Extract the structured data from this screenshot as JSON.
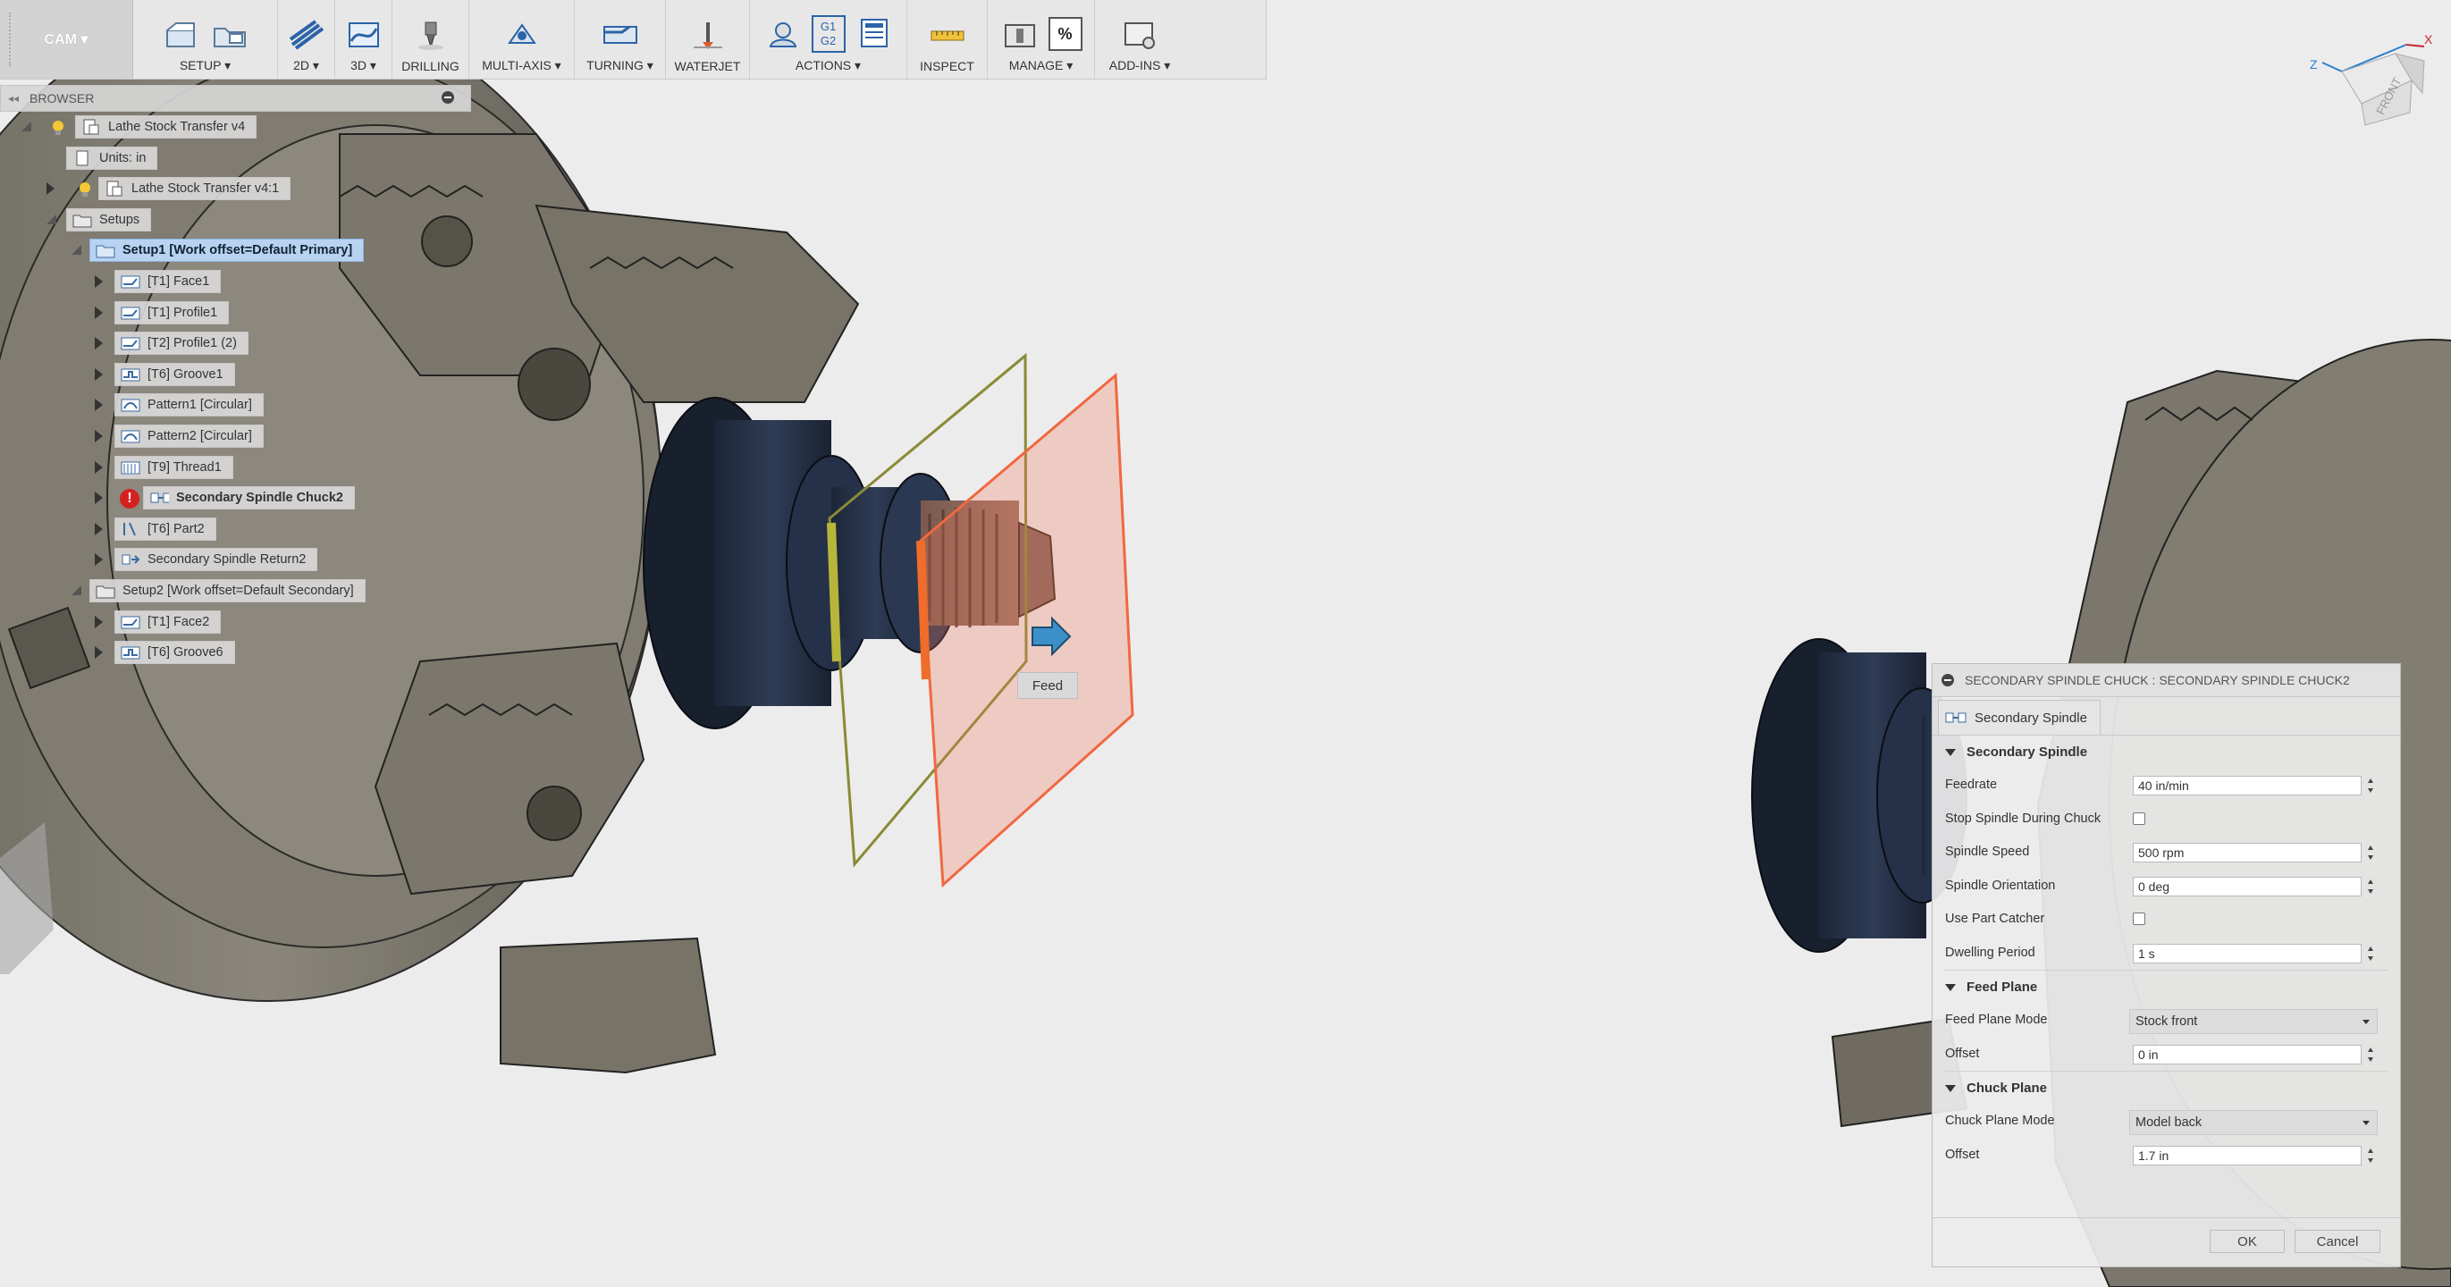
{
  "toolbar": {
    "workspace": "CAM ▾",
    "groups": [
      {
        "label": "SETUP ▾"
      },
      {
        "label": "2D ▾"
      },
      {
        "label": "3D ▾"
      },
      {
        "label": "DRILLING"
      },
      {
        "label": "MULTI-AXIS ▾"
      },
      {
        "label": "TURNING ▾"
      },
      {
        "label": "WATERJET"
      },
      {
        "label": "ACTIONS ▾"
      },
      {
        "label": "INSPECT"
      },
      {
        "label": "MANAGE ▾"
      },
      {
        "label": "ADD-INS ▾"
      }
    ],
    "actions_g1": "G1",
    "actions_g2": "G2",
    "manage_percent": "%"
  },
  "browser": {
    "title": "BROWSER",
    "items": [
      {
        "label": "Lathe Stock Transfer v4"
      },
      {
        "label": "Units: in"
      },
      {
        "label": "Lathe Stock Transfer v4:1"
      },
      {
        "label": "Setups"
      },
      {
        "label": "Setup1 [Work offset=Default Primary]"
      },
      {
        "label": "[T1] Face1"
      },
      {
        "label": "[T1] Profile1"
      },
      {
        "label": "[T2] Profile1 (2)"
      },
      {
        "label": "[T6] Groove1"
      },
      {
        "label": "Pattern1 [Circular]"
      },
      {
        "label": "Pattern2 [Circular]"
      },
      {
        "label": "[T9] Thread1"
      },
      {
        "label": "Secondary Spindle Chuck2"
      },
      {
        "label": "[T6] Part2"
      },
      {
        "label": "Secondary Spindle Return2"
      },
      {
        "label": "Setup2 [Work offset=Default Secondary]"
      },
      {
        "label": "[T1] Face2"
      },
      {
        "label": "[T6] Groove6"
      }
    ],
    "error_mark": "!"
  },
  "viewport": {
    "feed_label": "Feed",
    "viewcube_face": "FRONT",
    "axis_z": "Z",
    "axis_x": "X"
  },
  "dialog": {
    "title": "SECONDARY SPINDLE CHUCK : SECONDARY SPINDLE CHUCK2",
    "tab": "Secondary Spindle",
    "section1": "Secondary Spindle",
    "feedrate_label": "Feedrate",
    "feedrate_value": "40 in/min",
    "stop_spindle_label": "Stop Spindle During Chuck",
    "stop_spindle_checked": false,
    "spindle_speed_label": "Spindle Speed",
    "spindle_speed_value": "500 rpm",
    "spindle_orientation_label": "Spindle Orientation",
    "spindle_orientation_value": "0 deg",
    "use_part_catcher_label": "Use Part Catcher",
    "use_part_catcher_checked": false,
    "dwelling_label": "Dwelling Period",
    "dwelling_value": "1 s",
    "section2": "Feed Plane",
    "feed_plane_mode_label": "Feed Plane Mode",
    "feed_plane_mode_value": "Stock front",
    "feed_offset_label": "Offset",
    "feed_offset_value": "0 in",
    "section3": "Chuck Plane",
    "chuck_plane_mode_label": "Chuck Plane Mode",
    "chuck_plane_mode_value": "Model back",
    "chuck_offset_label": "Offset",
    "chuck_offset_value": "1.7 in",
    "ok": "OK",
    "cancel": "Cancel"
  }
}
